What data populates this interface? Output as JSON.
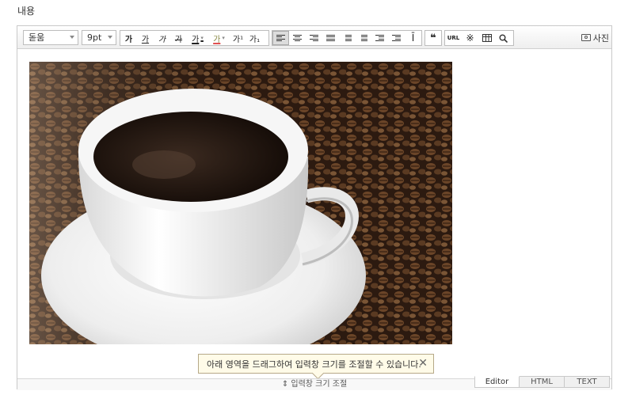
{
  "field_label": "내용",
  "toolbar": {
    "font_family": "돋움",
    "font_size": "9pt",
    "format_buttons": [
      "가",
      "가",
      "가",
      "가",
      "가",
      "가",
      "가¹",
      "가₁"
    ],
    "quote_glyph": "❝",
    "url_label": "URL",
    "special_char_glyph": "※",
    "photo_label": "사진"
  },
  "tooltip": {
    "text": "아래 영역을 드래그하여 입력창 크기를 조절할 수 있습니다."
  },
  "resize_bar": {
    "label": "⇕ 입력창 크기 조절"
  },
  "modes": [
    "Editor",
    "HTML",
    "TEXT"
  ],
  "active_mode": "Editor"
}
